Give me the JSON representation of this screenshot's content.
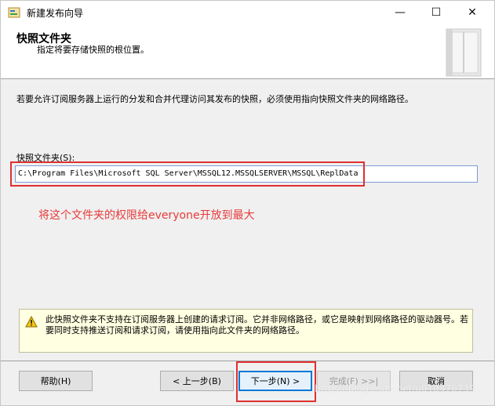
{
  "window": {
    "title": "新建发布向导",
    "minimize_glyph": "—",
    "maximize_glyph": "☐",
    "close_glyph": "✕"
  },
  "header": {
    "title": "快照文件夹",
    "subtitle": "指定将要存储快照的根位置。"
  },
  "main": {
    "description": "若要允许订阅服务器上运行的分发和合并代理访问其发布的快照，必须使用指向快照文件夹的网络路径。",
    "folder_label": "快照文件夹(S):",
    "folder_value": "C:\\Program Files\\Microsoft SQL Server\\MSSQL12.MSSQLSERVER\\MSSQL\\ReplData",
    "annotation": "将这个文件夹的权限给everyone开放到最大"
  },
  "warning": {
    "icon": "warning-icon",
    "text": "此快照文件夹不支持在订阅服务器上创建的请求订阅。它并非网络路径，或它是映射到网络路径的驱动器号。若要同时支持推送订阅和请求订阅，请使用指向此文件夹的网络路径。"
  },
  "buttons": {
    "help": "帮助(H)",
    "back": "< 上一步(B)",
    "next": "下一步(N) >",
    "finish": "完成(F) >>|",
    "cancel": "取消"
  },
  "watermark": "https://blog.csdn.net/u010476739",
  "colors": {
    "annotation_red": "#e03030",
    "warning_bg": "#ffffe1",
    "accent_blue": "#0078d7"
  }
}
